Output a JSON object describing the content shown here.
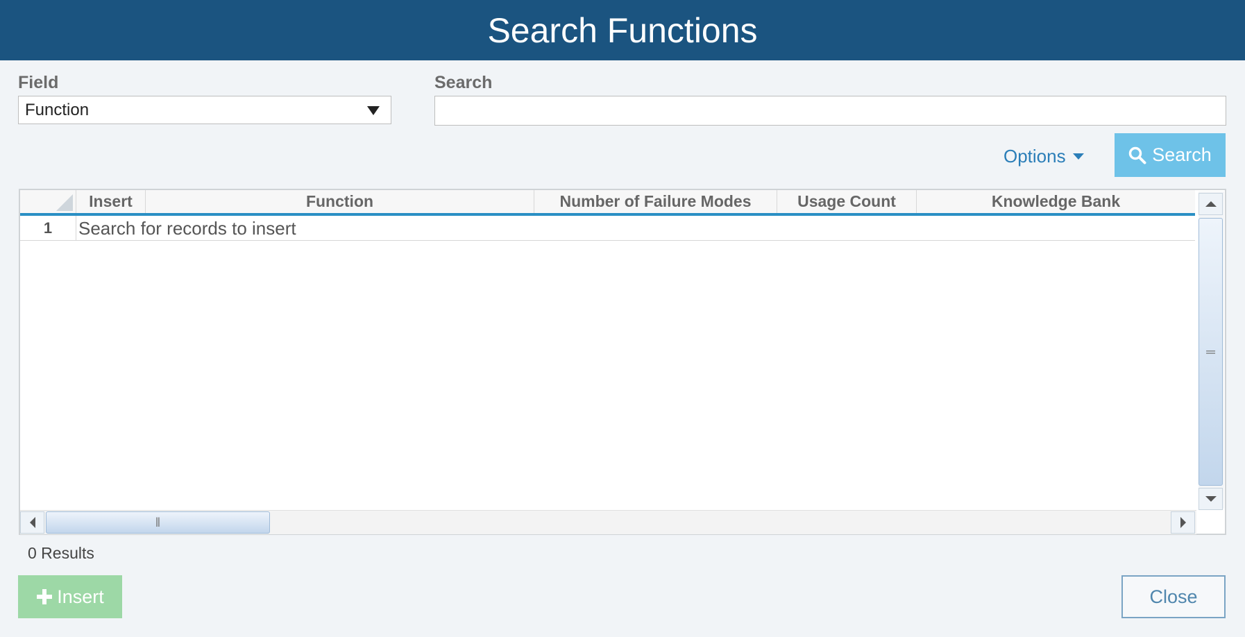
{
  "dialog": {
    "title": "Search Functions"
  },
  "field": {
    "label": "Field",
    "selected": "Function"
  },
  "search": {
    "label": "Search",
    "value": "",
    "placeholder": ""
  },
  "toolbar": {
    "options_label": "Options",
    "search_button_label": "Search"
  },
  "grid": {
    "columns": [
      "Insert",
      "Function",
      "Number of Failure Modes",
      "Usage Count",
      "Knowledge Bank"
    ],
    "rows": [
      {
        "number": "1",
        "message": "Search for records to insert"
      }
    ]
  },
  "footer": {
    "results_text": "0 Results",
    "insert_button_label": "Insert",
    "close_button_label": "Close"
  },
  "colors": {
    "title_bar": "#1b5480",
    "search_button": "#6ec2e8",
    "insert_button": "#9dd8a6",
    "header_underline": "#2a8fc4",
    "link": "#2b7eb8"
  },
  "icons": {
    "search_button_icon": "search-icon",
    "insert_button_icon": "plus-icon",
    "options_icon": "chevron-down-icon",
    "field_dropdown_icon": "chevron-down-icon"
  }
}
